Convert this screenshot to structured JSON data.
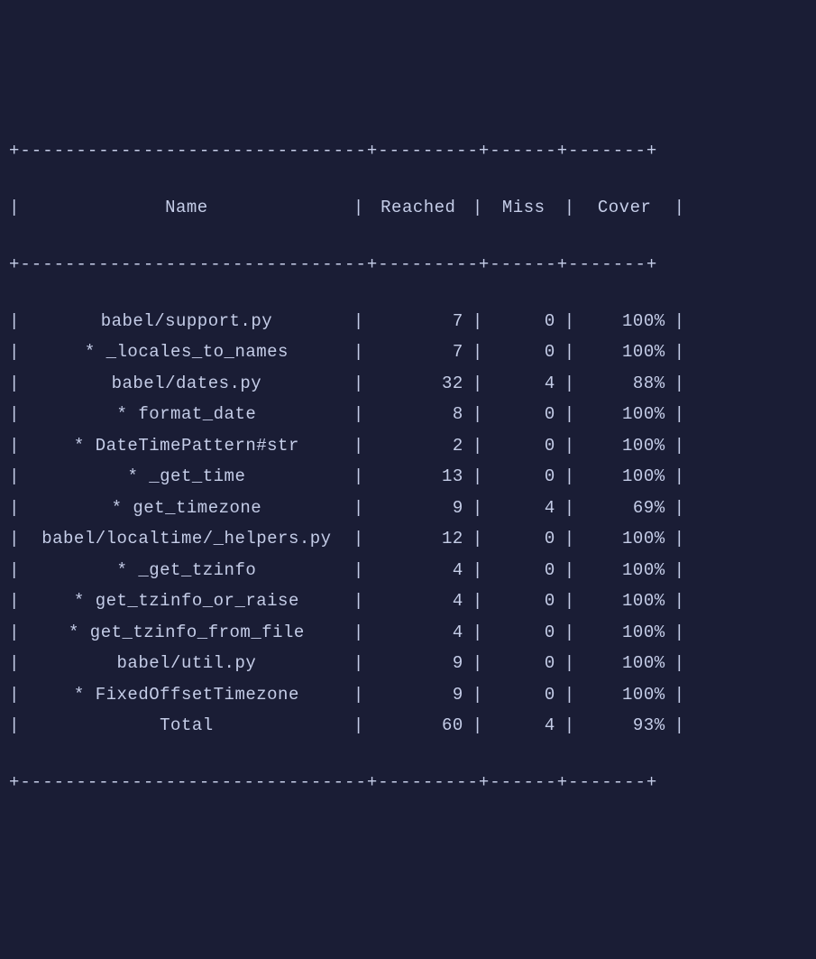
{
  "table": {
    "border_top": "+-------------------------------+---------+------+-------+",
    "border_mid": "+-------------------------------+---------+------+-------+",
    "border_bottom": "+-------------------------------+---------+------+-------+",
    "headers": {
      "name": "Name",
      "reached": "Reached",
      "miss": "Miss",
      "cover": "Cover"
    },
    "rows": [
      {
        "name": "babel/support.py",
        "reached": "7",
        "miss": "0",
        "cover": "100%"
      },
      {
        "name": "* _locales_to_names",
        "reached": "7",
        "miss": "0",
        "cover": "100%"
      },
      {
        "name": "babel/dates.py",
        "reached": "32",
        "miss": "4",
        "cover": "88%"
      },
      {
        "name": "* format_date",
        "reached": "8",
        "miss": "0",
        "cover": "100%"
      },
      {
        "name": "* DateTimePattern#str",
        "reached": "2",
        "miss": "0",
        "cover": "100%"
      },
      {
        "name": "* _get_time",
        "reached": "13",
        "miss": "0",
        "cover": "100%"
      },
      {
        "name": "* get_timezone",
        "reached": "9",
        "miss": "4",
        "cover": "69%"
      },
      {
        "name": "babel/localtime/_helpers.py",
        "reached": "12",
        "miss": "0",
        "cover": "100%"
      },
      {
        "name": "* _get_tzinfo",
        "reached": "4",
        "miss": "0",
        "cover": "100%"
      },
      {
        "name": "* get_tzinfo_or_raise",
        "reached": "4",
        "miss": "0",
        "cover": "100%"
      },
      {
        "name": "* get_tzinfo_from_file",
        "reached": "4",
        "miss": "0",
        "cover": "100%"
      },
      {
        "name": "babel/util.py",
        "reached": "9",
        "miss": "0",
        "cover": "100%"
      },
      {
        "name": "* FixedOffsetTimezone",
        "reached": "9",
        "miss": "0",
        "cover": "100%"
      },
      {
        "name": "Total",
        "reached": "60",
        "miss": "4",
        "cover": "93%"
      }
    ]
  }
}
